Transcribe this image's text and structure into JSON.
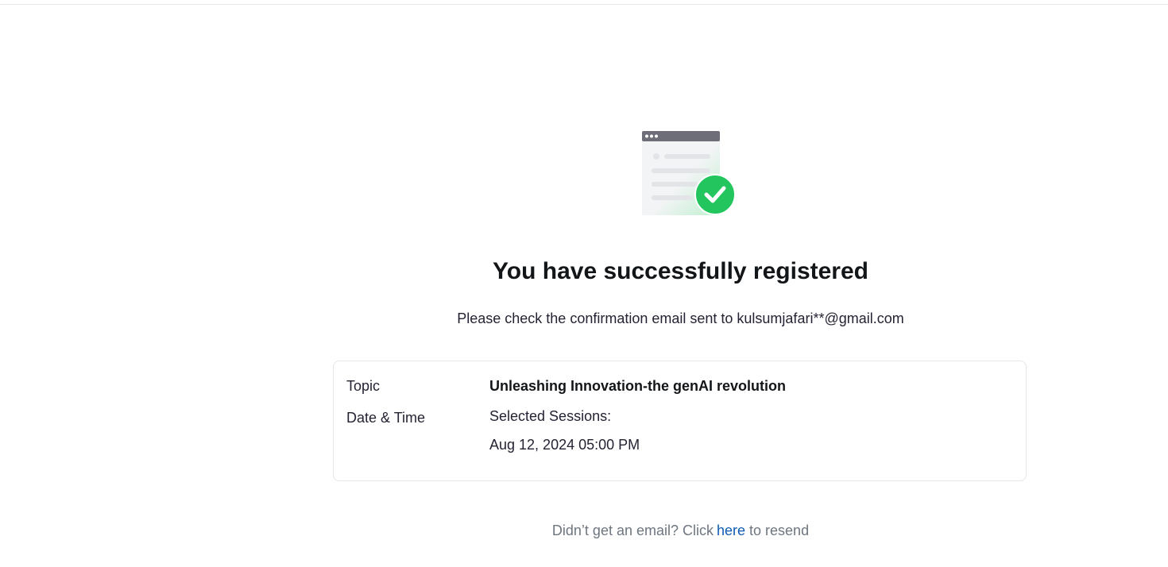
{
  "confirmation": {
    "title": "You have successfully registered",
    "message": "Please check the confirmation email sent to kulsumjafari**@gmail.com"
  },
  "details": {
    "topic_label": "Topic",
    "topic_value": "Unleashing Innovation-the genAI revolution",
    "datetime_label": "Date & Time",
    "sessions_label": "Selected Sessions:",
    "session_value": "Aug 12, 2024 05:00 PM"
  },
  "resend": {
    "prefix": "Didn’t get an email? Click",
    "link_label": "here",
    "suffix": "to resend"
  },
  "colors": {
    "success_green": "#22c55e",
    "link_blue": "#0e5ab5",
    "window_bar": "#6e6e78"
  },
  "icons": {
    "illustration": "browser-window-check-icon"
  }
}
